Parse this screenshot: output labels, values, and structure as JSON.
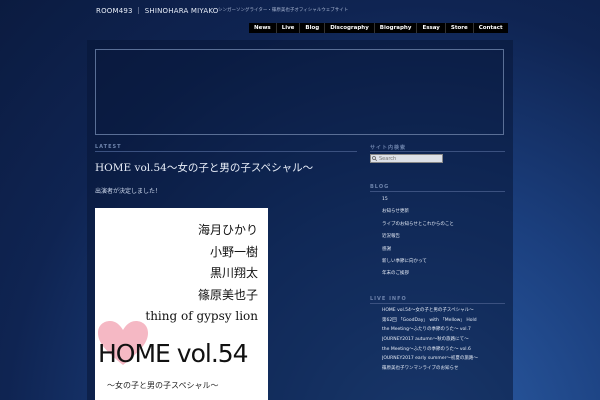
{
  "site": {
    "title": "ROOM493 ｜ SHINOHARA MIYAKO",
    "tagline": "シンガーソングライター・篠原美也子オフィシャルウェブサイト"
  },
  "nav": [
    "News",
    "Live",
    "Blog",
    "Discography",
    "Biography",
    "Essay",
    "Store",
    "Contact"
  ],
  "main": {
    "section_label": "LATEST",
    "post_title": "HOME vol.54～女の子と男の子スペシャル～",
    "post_subtitle": "出演者が決定しました！",
    "flyer": {
      "names": [
        "海月ひかり",
        "小野一樹",
        "黒川翔太",
        "篠原美也子",
        "thing of gypsy lion"
      ],
      "home_title": "HOME vol.54",
      "tagline": "～女の子と男の子スペシャル～"
    }
  },
  "sidebar": {
    "search_label": "サイト内検索",
    "search_placeholder": "Search",
    "blog_label": "BLOG",
    "blog_items": [
      "15",
      "お知らせ更新",
      "ライブのお知らせとこれからのこと",
      "近況報告",
      "感謝",
      "新しい季節に向かって",
      "年末のご挨拶"
    ],
    "live_label": "LIVE INFO",
    "live_items": [
      "HOME vol.54～女の子と男の子スペシャル～",
      "第62回 「GoodDay」 with 「Mellow」 Hold",
      "the Meeting～ふたりの季節のうた～ vol.7",
      "JOURNEY2017 autumn～秋の旅路にて～",
      "the Meeting～ふたりの季節のうた～ vol.6",
      "JOURNEY2017 early summer～初夏の旅路～",
      "篠原美也子ワンマンライブのお知らせ"
    ]
  },
  "colors": {
    "background_deep": "#0b1b40",
    "background_glow": "#2d5fa8",
    "nav_bg": "#000000",
    "flyer_heart": "#f5b8c4"
  }
}
